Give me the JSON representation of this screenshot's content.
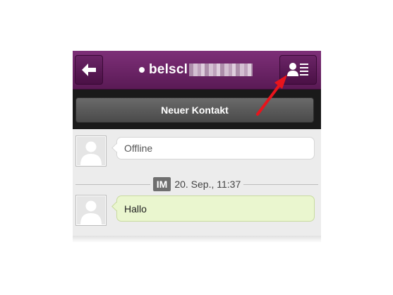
{
  "header": {
    "back_icon": "back-arrow-icon",
    "status_color": "#ffffff",
    "title": "belscl",
    "contact_icon": "contact-list-icon",
    "background": "#6a2366"
  },
  "action_bar": {
    "new_contact_label": "Neuer Kontakt"
  },
  "chat": {
    "status_message": "Offline",
    "separator": {
      "badge": "IM",
      "timestamp": "20. Sep., 11:37"
    },
    "messages": [
      {
        "text": "Hallo"
      }
    ]
  },
  "annotation": {
    "arrow_color": "#e8141c",
    "arrow_icon": "red-arrow-icon"
  }
}
